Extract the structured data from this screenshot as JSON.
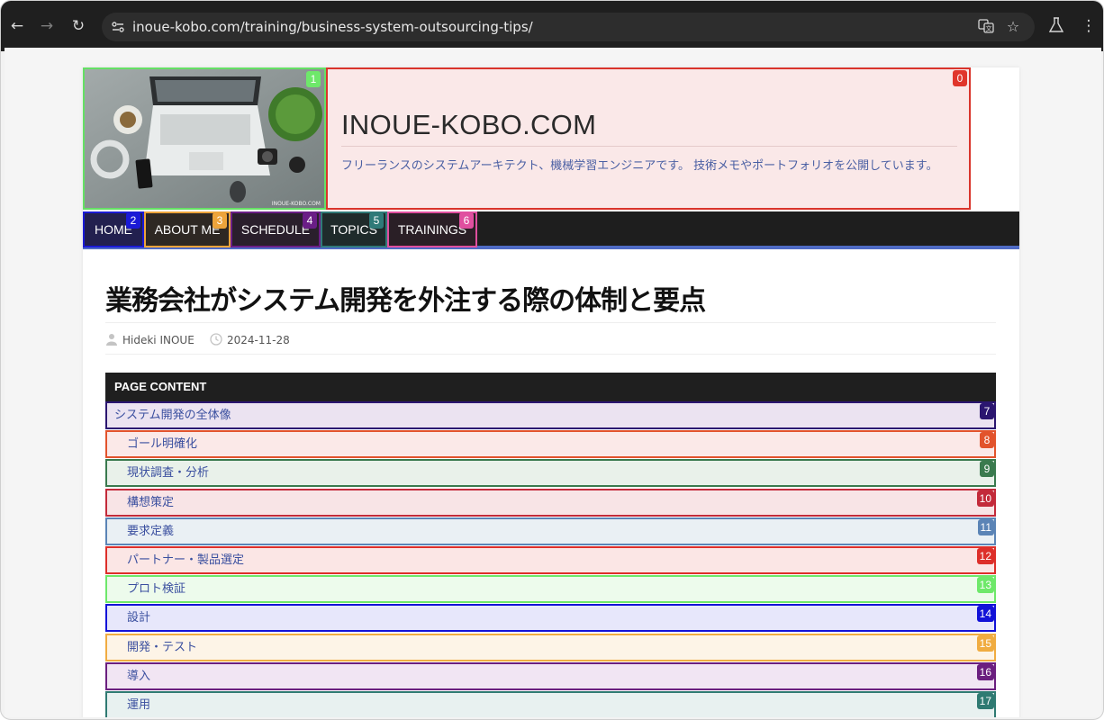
{
  "browser": {
    "url": "inoue-kobo.com/training/business-system-outsourcing-tips/",
    "icons": [
      "back-icon",
      "forward-icon",
      "reload-icon",
      "site-info-icon",
      "translate-icon",
      "bookmark-star-icon",
      "labs-icon",
      "menu-icon"
    ]
  },
  "site": {
    "title": "INOUE-KOBO.COM",
    "tagline": "フリーランスのシステムアーキテクト、機械学習エンジニアです。 技術メモやポートフォリオを公開しています。",
    "image_caption": "INOUE-KOBO.COM"
  },
  "badges": {
    "header": "0",
    "image": "1"
  },
  "nav": [
    {
      "label": "HOME",
      "badge": "2",
      "color": "#1a1ad6",
      "bg": "#22204f"
    },
    {
      "label": "ABOUT ME",
      "badge": "3",
      "color": "#eda43b",
      "bg": "#2e2823"
    },
    {
      "label": "SCHEDULE",
      "badge": "4",
      "color": "#6a1e86",
      "bg": "#2a1f2c"
    },
    {
      "label": "TOPICS",
      "badge": "5",
      "color": "#2f7a78",
      "bg": "#1f2b2b"
    },
    {
      "label": "TRAININGS",
      "badge": "6",
      "color": "#e04f9f",
      "bg": "#2a1f26"
    }
  ],
  "article": {
    "title": "業務会社がシステム開発を外注する際の体制と要点",
    "author": "Hideki INOUE",
    "date": "2024-11-28"
  },
  "toc": {
    "header": "PAGE CONTENT",
    "items": [
      {
        "label": "システム開発の全体像",
        "badge": "7",
        "color": "#2b1670",
        "bg": "#ebe3f1",
        "indent": 0
      },
      {
        "label": "ゴール明確化",
        "badge": "8",
        "color": "#e2532c",
        "bg": "#fbe9e8",
        "indent": 1
      },
      {
        "label": "現状調査・分析",
        "badge": "9",
        "color": "#3a7a4e",
        "bg": "#e9f1ea",
        "indent": 1
      },
      {
        "label": "構想策定",
        "badge": "10",
        "color": "#c32a3a",
        "bg": "#f8e4e6",
        "indent": 1
      },
      {
        "label": "要求定義",
        "badge": "11",
        "color": "#5b84b6",
        "bg": "#eaf0f4",
        "indent": 1
      },
      {
        "label": "パートナー・製品選定",
        "badge": "12",
        "color": "#dd2f2a",
        "bg": "#fbe6e5",
        "indent": 1
      },
      {
        "label": "プロト検証",
        "badge": "13",
        "color": "#6ee86a",
        "bg": "#edfbec",
        "indent": 1
      },
      {
        "label": "設計",
        "badge": "14",
        "color": "#1212d8",
        "bg": "#e7e7fb",
        "indent": 1
      },
      {
        "label": "開発・テスト",
        "badge": "15",
        "color": "#f0ac41",
        "bg": "#fdf4e7",
        "indent": 1
      },
      {
        "label": "導入",
        "badge": "16",
        "color": "#6b1f7f",
        "bg": "#f1e5f3",
        "indent": 1
      },
      {
        "label": "運用",
        "badge": "17",
        "color": "#2f7a72",
        "bg": "#e8f1f0",
        "indent": 1
      }
    ]
  }
}
